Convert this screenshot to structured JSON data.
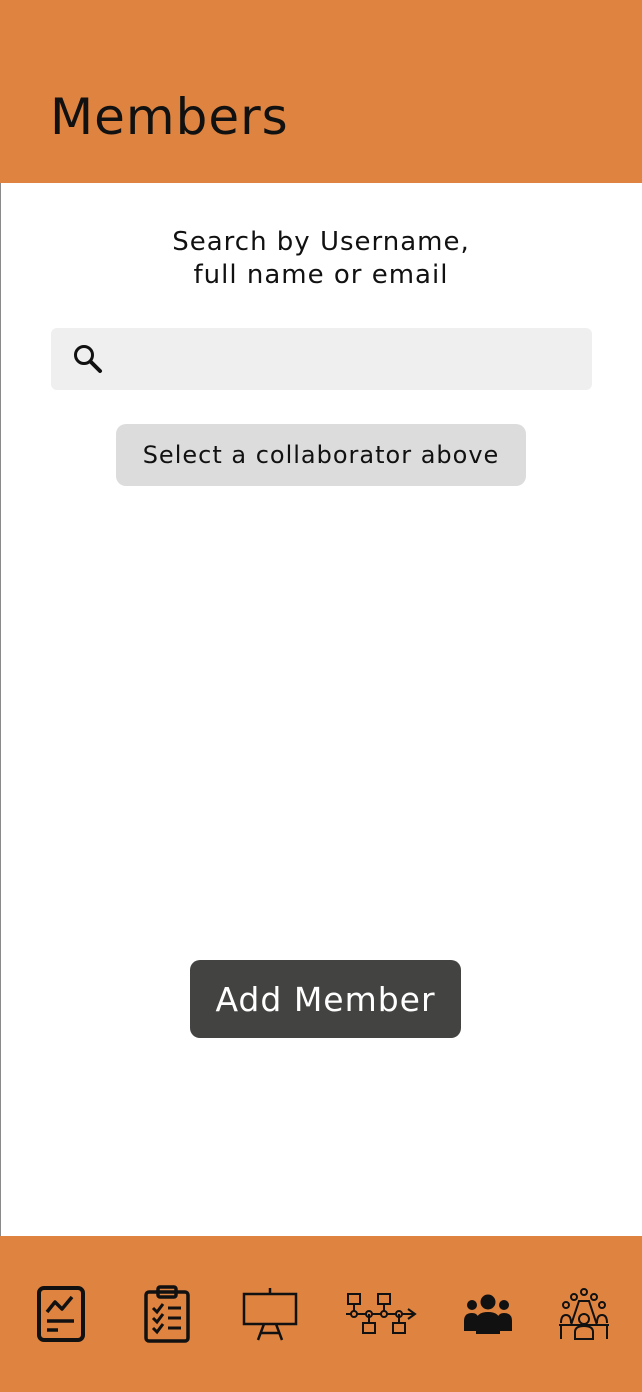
{
  "header": {
    "title": "Members"
  },
  "search": {
    "caption_line1": "Search by Username,",
    "caption_line2": "full name or email",
    "value": "",
    "icon": "search-icon"
  },
  "collaborator": {
    "status_label": "Select a collaborator above"
  },
  "actions": {
    "add_member_label": "Add Member"
  },
  "bottom_nav": {
    "items": [
      {
        "icon": "report-chart-icon"
      },
      {
        "icon": "task-checklist-icon"
      },
      {
        "icon": "presentation-board-icon"
      },
      {
        "icon": "workflow-timeline-icon"
      },
      {
        "icon": "members-group-icon",
        "active": true
      },
      {
        "icon": "meeting-table-icon"
      }
    ]
  },
  "colors": {
    "accent": "#de8340",
    "button": "#434341",
    "search_bg": "#efefef",
    "chip_bg": "#dcdcdc"
  }
}
